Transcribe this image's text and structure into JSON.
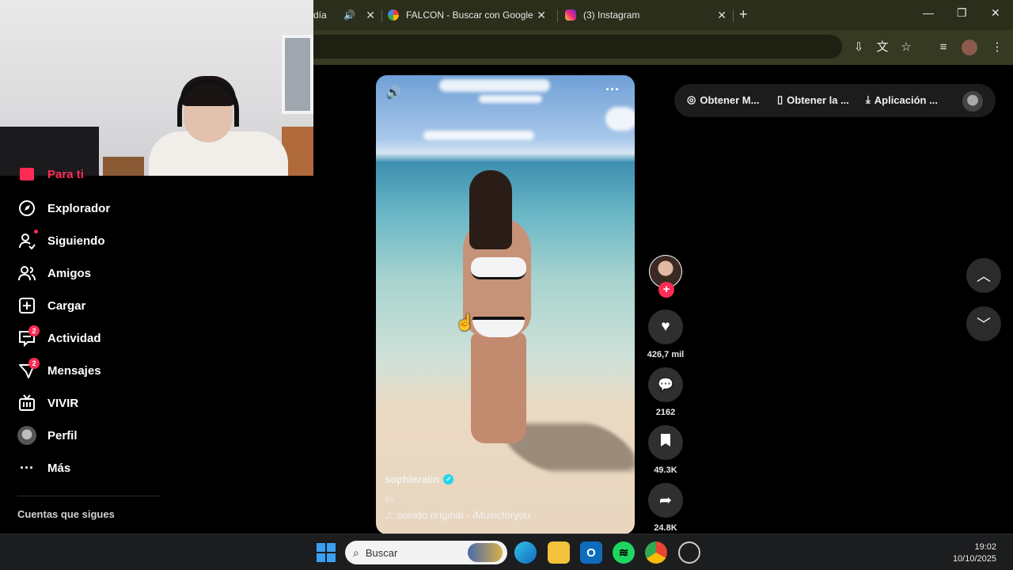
{
  "browser": {
    "tabs": [
      {
        "label": "día",
        "favicon": "audio-icon"
      },
      {
        "label": "FALCON - Buscar con Google",
        "favicon": "google-icon"
      },
      {
        "label": "(3) Instagram",
        "favicon": "instagram-icon"
      }
    ],
    "new_tab_label": "+",
    "close_glyph": "✕"
  },
  "sidebar": {
    "items": [
      {
        "label": "Para ti",
        "icon": "home-icon"
      },
      {
        "label": "Explorador",
        "icon": "compass-icon"
      },
      {
        "label": "Siguiendo",
        "icon": "following-icon"
      },
      {
        "label": "Amigos",
        "icon": "friends-icon"
      },
      {
        "label": "Cargar",
        "icon": "upload-icon"
      },
      {
        "label": "Actividad",
        "icon": "activity-icon",
        "badge": "2"
      },
      {
        "label": "Mensajes",
        "icon": "messages-icon",
        "badge": "2"
      },
      {
        "label": "VIVIR",
        "icon": "live-icon"
      },
      {
        "label": "Perfil",
        "icon": "profile-avatar-icon"
      },
      {
        "label": "Más",
        "icon": "more-icon"
      }
    ],
    "following_header": "Cuentas que sigues"
  },
  "topbar": {
    "links": [
      {
        "label": "Obtener M...",
        "icon": "coin-icon"
      },
      {
        "label": "Obtener la ...",
        "icon": "phone-icon"
      },
      {
        "label": "Aplicación ...",
        "icon": "download-icon"
      }
    ]
  },
  "video": {
    "author": "sophieraiin",
    "tag": "BS",
    "sound": "sonido original - iMusicforyou"
  },
  "actions": {
    "likes": "426,7 mil",
    "comments": "2162",
    "saves": "49.3K",
    "shares": "24.8K"
  },
  "taskbar": {
    "search_placeholder": "Buscar",
    "time": "19:02",
    "date": "10/10/2025"
  },
  "colors": {
    "accent": "#fe2c55",
    "verified": "#20d5ec",
    "tabbar": "#2b2e1a",
    "toolbar": "#363a23"
  }
}
